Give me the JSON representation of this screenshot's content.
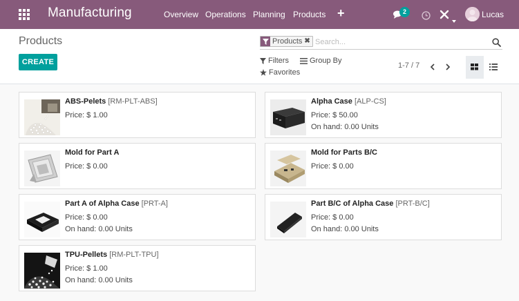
{
  "navbar": {
    "app_title": "Manufacturing",
    "menu": [
      "Overview",
      "Operations",
      "Planning",
      "Products"
    ],
    "plus": "+",
    "messages_count": "2",
    "user_name": "Lucas"
  },
  "control": {
    "breadcrumb": "Products",
    "create_label": "CREATE",
    "search": {
      "facet_label": "Products",
      "facet_close": "✖",
      "placeholder": "Search..."
    },
    "filters_label": "Filters",
    "group_by_label": "Group By",
    "favorites_label": "Favorites",
    "pager": "1-7 / 7"
  },
  "products": [
    {
      "name": "ABS-Pelets",
      "ref": "[RM-PLT-ABS]",
      "price": "Price: $ 1.00",
      "on_hand": "",
      "image": "pellets-white"
    },
    {
      "name": "Alpha Case",
      "ref": "[ALP-CS]",
      "price": "Price: $ 50.00",
      "on_hand": "On hand: 0.00 Units",
      "image": "black-box"
    },
    {
      "name": "Mold for Part A",
      "ref": "",
      "price": "Price: $ 0.00",
      "on_hand": "",
      "image": "mold-tray"
    },
    {
      "name": "Mold for Parts B/C",
      "ref": "",
      "price": "Price: $ 0.00",
      "on_hand": "",
      "image": "mold-tray-tan"
    },
    {
      "name": "Part A of Alpha Case",
      "ref": "[PRT-A]",
      "price": "Price: $ 0.00",
      "on_hand": "On hand: 0.00 Units",
      "image": "black-frame"
    },
    {
      "name": "Part B/C of Alpha Case",
      "ref": "[PRT-B/C]",
      "price": "Price: $ 0.00",
      "on_hand": "On hand: 0.00 Units",
      "image": "black-plate"
    },
    {
      "name": "TPU-Pellets",
      "ref": "[RM-PLT-TPU]",
      "price": "Price: $ 1.00",
      "on_hand": "On hand: 0.00 Units",
      "image": "pellets-dark"
    }
  ],
  "colors": {
    "navbar": "#875a7b",
    "accent": "#00a09d",
    "background": "#f9f9f9"
  }
}
